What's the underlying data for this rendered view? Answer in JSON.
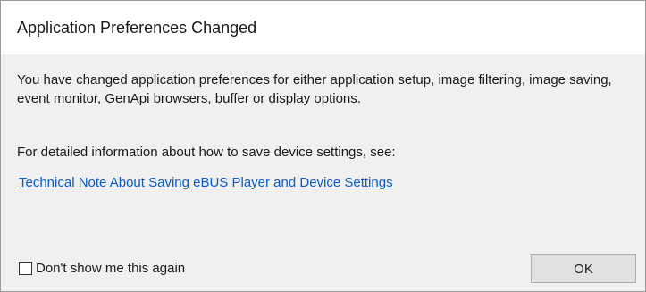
{
  "dialog": {
    "title": "Application Preferences Changed",
    "message": "You have changed application preferences for either application setup, image filtering, image saving, event monitor, GenApi browsers, buffer or display options.",
    "info": "For detailed information about how to save device settings, see:",
    "link_text": "Technical Note About Saving eBUS Player and Device Settings",
    "checkbox_label": "Don't show me this again",
    "checkbox_checked": false,
    "ok_label": "OK"
  },
  "colors": {
    "link": "#0b5cc4",
    "content_background": "#f0f0f0",
    "title_background": "#ffffff",
    "button_background": "#e1e1e1"
  }
}
